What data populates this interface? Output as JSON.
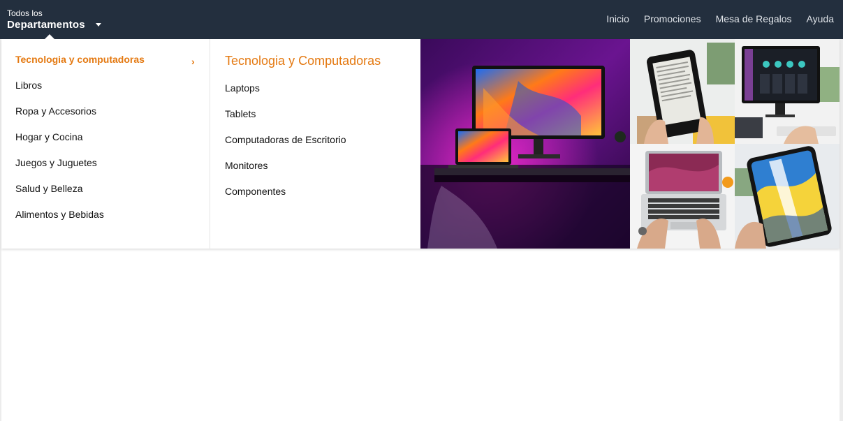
{
  "header": {
    "dept_small": "Todos los",
    "dept_big": "Departamentos",
    "nav": [
      "Inicio",
      "Promociones",
      "Mesa de Regalos",
      "Ayuda"
    ]
  },
  "menu": {
    "departments": [
      {
        "label": "Tecnologia y computadoras",
        "active": true
      },
      {
        "label": "Libros"
      },
      {
        "label": "Ropa y Accesorios"
      },
      {
        "label": "Hogar y Cocina"
      },
      {
        "label": "Juegos y Juguetes"
      },
      {
        "label": "Salud y Belleza"
      },
      {
        "label": "Alimentos y Bebidas"
      }
    ],
    "sub_title": "Tecnologia y Computadoras",
    "sub_items": [
      "Laptops",
      "Tablets",
      "Computadoras de Escritorio",
      "Monitores",
      "Componentes"
    ]
  },
  "colors": {
    "topbar": "#232f3e",
    "accent": "#e47911",
    "text": "#111111"
  },
  "icons": {
    "dept_caret": "caret-down-icon",
    "active_indicator": "chevron-right-icon"
  }
}
